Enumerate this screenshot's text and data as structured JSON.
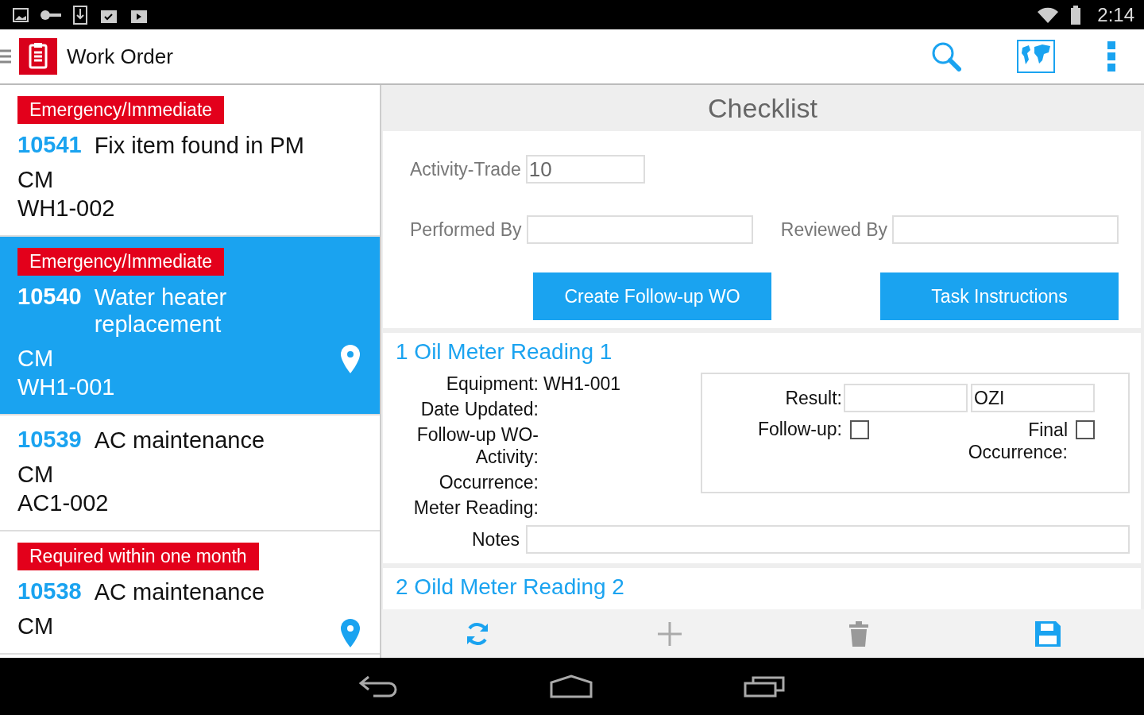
{
  "status_bar": {
    "time": "2:14"
  },
  "app_bar": {
    "title": "Work Order"
  },
  "work_orders": [
    {
      "priority": "Emergency/Immediate",
      "number": "10541",
      "title": "Fix item found in PM",
      "type": "CM",
      "location": "WH1-002",
      "has_pin": false,
      "selected": false
    },
    {
      "priority": "Emergency/Immediate",
      "number": "10540",
      "title": "Water heater replacement",
      "type": "CM",
      "location": "WH1-001",
      "has_pin": true,
      "selected": true
    },
    {
      "number": "10539",
      "title": "AC maintenance",
      "type": "CM",
      "location": "AC1-002",
      "has_pin": false,
      "selected": false
    },
    {
      "priority": "Required within one month",
      "number": "10538",
      "title": "AC maintenance",
      "type": "CM",
      "has_pin": true,
      "selected": false
    }
  ],
  "checklist": {
    "title": "Checklist",
    "activity_trade": {
      "label": "Activity-Trade",
      "value": "10"
    },
    "performed_by": {
      "label": "Performed By"
    },
    "reviewed_by": {
      "label": "Reviewed By"
    },
    "buttons": [
      "Create Follow-up WO",
      "Task Instructions"
    ],
    "tasks": [
      {
        "title": "1 Oil Meter Reading 1",
        "details": [
          {
            "label": "Equipment:",
            "value": "WH1-001"
          },
          {
            "label": "Date Updated:"
          },
          {
            "label": "Follow-up WO-Activity:"
          },
          {
            "label": "Occurrence:"
          },
          {
            "label": "Meter Reading:"
          }
        ],
        "result_label": "Result:",
        "result_unit": "OZI",
        "follow_up": {
          "label": "Follow-up:",
          "checked": false
        },
        "final_occurrence": {
          "label": "Final Occurrence:",
          "checked": false
        },
        "notes_label": "Notes"
      },
      {
        "title": "2 Oild Meter Reading 2"
      }
    ]
  }
}
